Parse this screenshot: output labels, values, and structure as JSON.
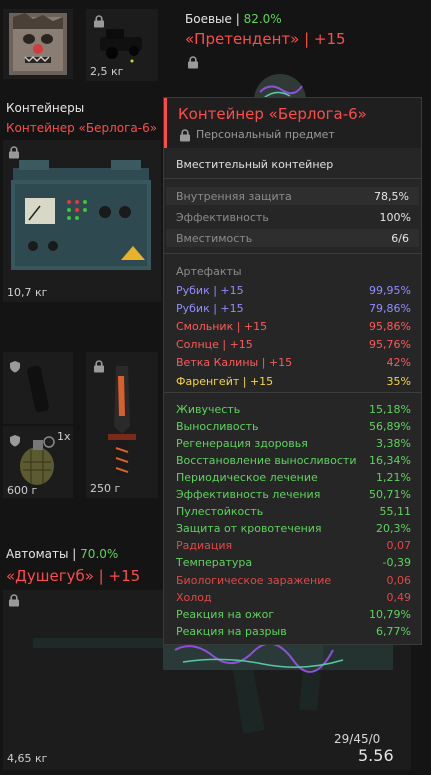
{
  "top_cell_1": {
    "lock": false
  },
  "top_cell_2": {
    "weight": "2,5 кг"
  },
  "armor": {
    "category": "Боевые |",
    "percent": "82.0%",
    "name": "«Претендент» | +15"
  },
  "container_slot": {
    "category": "Контейнеры",
    "name": "Контейнер «Берлога-6»",
    "weight": "10,7 кг"
  },
  "small_items": {
    "item1_weight": "",
    "grenade_count": "1x",
    "grenade_weight": "600 г",
    "knife_weight": "250 г"
  },
  "weapon": {
    "category": "Автоматы |",
    "percent": "70.0%",
    "name": "«Душегуб» | +15",
    "weight": "4,65 кг",
    "ammo": "29/45/0",
    "version": "5.56"
  },
  "tooltip": {
    "title": "Контейнер «Берлога-6»",
    "personal": "Персональный предмет",
    "type": "Вместительный контейнер",
    "stats": [
      {
        "label": "Внутренняя защита",
        "value": "78,5%"
      },
      {
        "label": "Эффективность",
        "value": "100%"
      },
      {
        "label": "Вместимость",
        "value": "6/6"
      }
    ],
    "artifacts_title": "Артефакты",
    "artifacts": [
      {
        "name": "Рубик | +15",
        "value": "99,95%",
        "color": "#8f8fff"
      },
      {
        "name": "Рубик | +15",
        "value": "79,86%",
        "color": "#8f8fff"
      },
      {
        "name": "Смольник | +15",
        "value": "95,86%",
        "color": "#ff5a5a"
      },
      {
        "name": "Солнце | +15",
        "value": "95,76%",
        "color": "#ff5a5a"
      },
      {
        "name": "Ветка Калины | +15",
        "value": "42%",
        "color": "#ff5a5a"
      },
      {
        "name": "Фаренгейт | +15",
        "value": "35%",
        "color": "#f5d547"
      }
    ],
    "effects": [
      {
        "label": "Живучесть",
        "value": "15,18%",
        "color": "#5fd35f"
      },
      {
        "label": "Выносливость",
        "value": "56,89%",
        "color": "#5fd35f"
      },
      {
        "label": "Регенерация здоровья",
        "value": "3,38%",
        "color": "#5fd35f"
      },
      {
        "label": "Восстановление выносливости",
        "value": "16,34%",
        "color": "#5fd35f"
      },
      {
        "label": "Периодическое лечение",
        "value": "1,21%",
        "color": "#5fd35f"
      },
      {
        "label": "Эффективность лечения",
        "value": "50,71%",
        "color": "#5fd35f"
      },
      {
        "label": "Пулестойкость",
        "value": "55,11",
        "color": "#5fd35f"
      },
      {
        "label": "Защита от кровотечения",
        "value": "20,3%",
        "color": "#5fd35f"
      },
      {
        "label": "Радиация",
        "value": "0,07",
        "color": "#e04848"
      },
      {
        "label": "Температура",
        "value": "-0,39",
        "color": "#5fd35f"
      },
      {
        "label": "Биологическое заражение",
        "value": "0,06",
        "color": "#e04848"
      },
      {
        "label": "Холод",
        "value": "0,49",
        "color": "#e04848"
      },
      {
        "label": "Реакция на ожог",
        "value": "10,79%",
        "color": "#5fd35f"
      },
      {
        "label": "Реакция на разрыв",
        "value": "6,77%",
        "color": "#5fd35f"
      }
    ]
  },
  "colors": {
    "accent_red": "#ff4b4b",
    "green": "#5fd35f",
    "artifact_blue": "#8f8fff",
    "artifact_yellow": "#f5d547"
  },
  "icons": [
    "lock-icon",
    "shield-icon"
  ]
}
